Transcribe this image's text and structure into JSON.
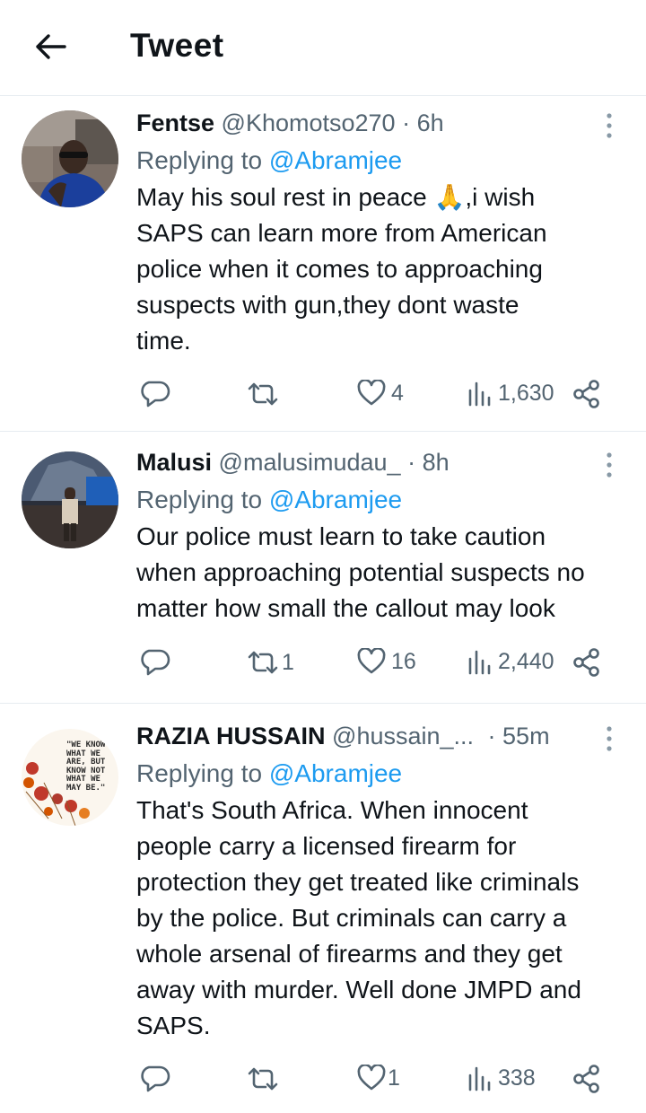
{
  "header": {
    "title": "Tweet",
    "back_icon": "arrow-left-icon"
  },
  "tweets": [
    {
      "name": "Fentse",
      "handle": "@Khomotso270",
      "time": "· 6h",
      "replying_prefix": "Replying to ",
      "replying_to": "@Abramjee",
      "text_lines": [
        "May his soul rest in peace 🙏,i wish",
        "SAPS can learn more from American",
        "police when it comes to approaching",
        "suspects with gun,they dont waste",
        "time."
      ],
      "stats": {
        "replies": "",
        "retweets": "",
        "likes": "4",
        "views": "1,630"
      }
    },
    {
      "name": "Malusi",
      "handle": "@malusimudau_",
      "time": "· 8h",
      "replying_prefix": "Replying to ",
      "replying_to": "@Abramjee",
      "text_lines": [
        "Our police must learn to take caution",
        "when approaching potential suspects no",
        "matter how small the callout may look"
      ],
      "stats": {
        "replies": "",
        "retweets": "1",
        "likes": "16",
        "views": "2,440"
      }
    },
    {
      "name": "RAZIA HUSSAIN",
      "handle": "@hussain_...",
      "time": "· 55m",
      "replying_prefix": "Replying to ",
      "replying_to": "@Abramjee",
      "avatar_quote": [
        "\"WE KNOW",
        "WHAT WE",
        "ARE, BUT",
        "KNOW NOT",
        "WHAT WE",
        "MAY BE.\""
      ],
      "text_lines": [
        "That's South Africa. When innocent",
        "people carry a licensed firearm for",
        "protection they get treated like criminals",
        "by the police. But criminals can carry a",
        "whole arsenal of firearms and they get",
        "away with murder. Well done JMPD and",
        "SAPS."
      ],
      "stats": {
        "replies": "",
        "retweets": "",
        "likes": "1",
        "views": "338"
      }
    }
  ],
  "colors": {
    "accent": "#1d9bf0",
    "secondary": "#536471",
    "text": "#0f1419",
    "divider": "#e6ecf0"
  }
}
